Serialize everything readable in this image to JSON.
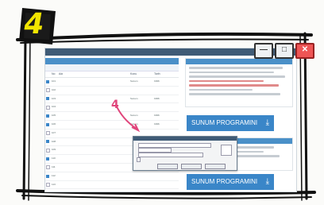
{
  "step_number": "4",
  "annotation": "4",
  "window_controls": {
    "minimize": "—",
    "maximize": "□",
    "close": "✕"
  },
  "navbar": {
    "items": [
      "",
      "",
      "",
      "",
      ""
    ]
  },
  "left_panel": {
    "header": "",
    "toolbar": "",
    "columns": [
      "No",
      "Adı",
      "Konu",
      "Tarih"
    ],
    "rows": [
      {
        "checked": true,
        "no": "101",
        "name": "",
        "type": "Sunum",
        "date": "1996"
      },
      {
        "checked": false,
        "no": "102",
        "name": "",
        "type": "",
        "date": ""
      },
      {
        "checked": true,
        "no": "103",
        "name": "",
        "type": "Sunum",
        "date": "1996"
      },
      {
        "checked": false,
        "no": "104",
        "name": "",
        "type": "",
        "date": ""
      },
      {
        "checked": true,
        "no": "105",
        "name": "",
        "type": "Sunum",
        "date": "1996"
      },
      {
        "checked": true,
        "no": "106",
        "name": "",
        "type": "Sunum",
        "date": "1996"
      },
      {
        "checked": false,
        "no": "107",
        "name": "",
        "type": "",
        "date": ""
      },
      {
        "checked": true,
        "no": "108",
        "name": "",
        "type": "",
        "date": ""
      },
      {
        "checked": false,
        "no": "109",
        "name": "",
        "type": "",
        "date": ""
      },
      {
        "checked": true,
        "no": "110",
        "name": "",
        "type": "",
        "date": ""
      },
      {
        "checked": false,
        "no": "111",
        "name": "",
        "type": "",
        "date": ""
      },
      {
        "checked": true,
        "no": "112",
        "name": "",
        "type": "",
        "date": ""
      },
      {
        "checked": false,
        "no": "113",
        "name": "",
        "type": "",
        "date": ""
      },
      {
        "checked": false,
        "no": "114",
        "name": "",
        "type": "",
        "date": ""
      },
      {
        "checked": false,
        "no": "115",
        "name": "",
        "type": "",
        "date": ""
      }
    ]
  },
  "right_panel": {
    "download_button_top": "SUNUM PROGRAMINI İNDİR",
    "download_button_bottom": "SUNUM PROGRAMINI İNDİR"
  },
  "dialog": {
    "title": "",
    "fields": [
      "",
      "",
      ""
    ],
    "checkbox_label": "",
    "buttons": [
      "",
      "",
      ""
    ]
  },
  "colors": {
    "accent": "#3a86c8",
    "annotation": "#e0457b",
    "step_badge": "#f2e500"
  }
}
